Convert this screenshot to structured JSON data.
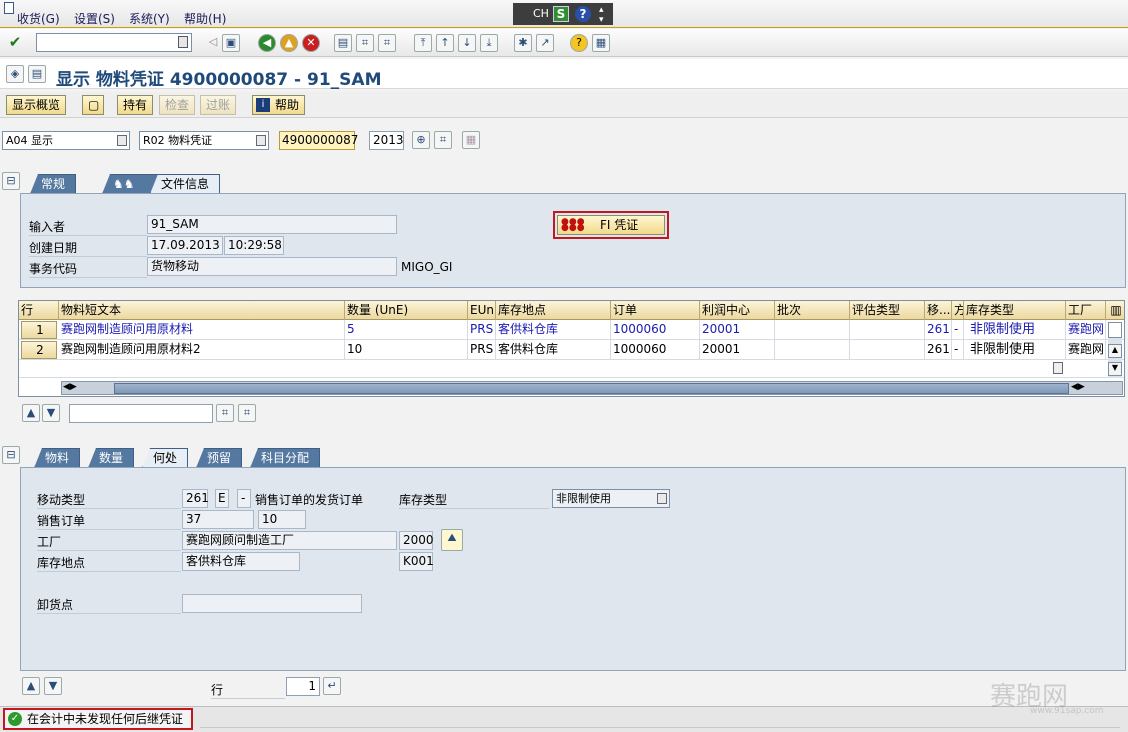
{
  "menu": {
    "items": [
      "收货(G)",
      "设置(S)",
      "系统(Y)",
      "帮助(H)"
    ],
    "lang": "CH",
    "lang_s": "S",
    "lang_q": "?"
  },
  "title": "显示 物料凭证 4900000087 - 91_SAM",
  "app_buttons": {
    "overview": "显示概览",
    "hold": "持有",
    "check": "检查",
    "post": "过账",
    "help": "帮助"
  },
  "selector": {
    "action": "A04 显示",
    "reference": "R02 物料凭证",
    "document": "4900000087",
    "year": "2013"
  },
  "header_tabs": [
    "常规",
    "文件信息"
  ],
  "doc_info": {
    "entered_by_label": "输入者",
    "entered_by": "91_SAM",
    "created_label": "创建日期",
    "created_date": "17.09.2013",
    "created_time": "10:29:58",
    "tcode_label": "事务代码",
    "tcode_text": "货物移动",
    "tcode": "MIGO_GI",
    "fi_button": "FI 凭证"
  },
  "grid": {
    "columns": [
      "行",
      "物料短文本",
      "数量 (UnE)",
      "EUn",
      "库存地点",
      "订单",
      "利润中心",
      "批次",
      "评估类型",
      "移...",
      "方",
      "库存类型",
      "工厂"
    ],
    "rows": [
      {
        "line": "1",
        "text": "赛跑网制造顾问用原材料",
        "qty": "5",
        "unit": "PRS",
        "sloc": "客供料仓库",
        "order": "1000060",
        "profit": "20001",
        "batch": "",
        "valtype": "",
        "mvt": "261",
        "dir": "-",
        "stocktype": "非限制使用",
        "plant": "赛跑网"
      },
      {
        "line": "2",
        "text": "赛跑网制造顾问用原材料2",
        "qty": "10",
        "unit": "PRS",
        "sloc": "客供料仓库",
        "order": "1000060",
        "profit": "20001",
        "batch": "",
        "valtype": "",
        "mvt": "261",
        "dir": "-",
        "stocktype": "非限制使用",
        "plant": "赛跑网"
      }
    ]
  },
  "detail_tabs": [
    "物料",
    "数量",
    "何处",
    "预留",
    "科目分配"
  ],
  "detail": {
    "mvt_label": "移动类型",
    "mvt": "261",
    "special": "E",
    "dash": "-",
    "mvt_text": "销售订单的发货订单",
    "stock_type_label": "库存类型",
    "stock_type": "非限制使用",
    "so_label": "销售订单",
    "so": "37",
    "so_item": "10",
    "plant_label": "工厂",
    "plant_name": "赛跑网顾问制造工厂",
    "plant": "2000",
    "sloc_label": "库存地点",
    "sloc_name": "客供料仓库",
    "sloc": "K001",
    "unload_label": "卸货点",
    "unload": ""
  },
  "footer": {
    "line_label": "行",
    "line_value": "1"
  },
  "status": {
    "message": "在会计中未发现任何后继凭证"
  },
  "watermark": "赛跑网",
  "watermark_url": "www.91sap.com"
}
